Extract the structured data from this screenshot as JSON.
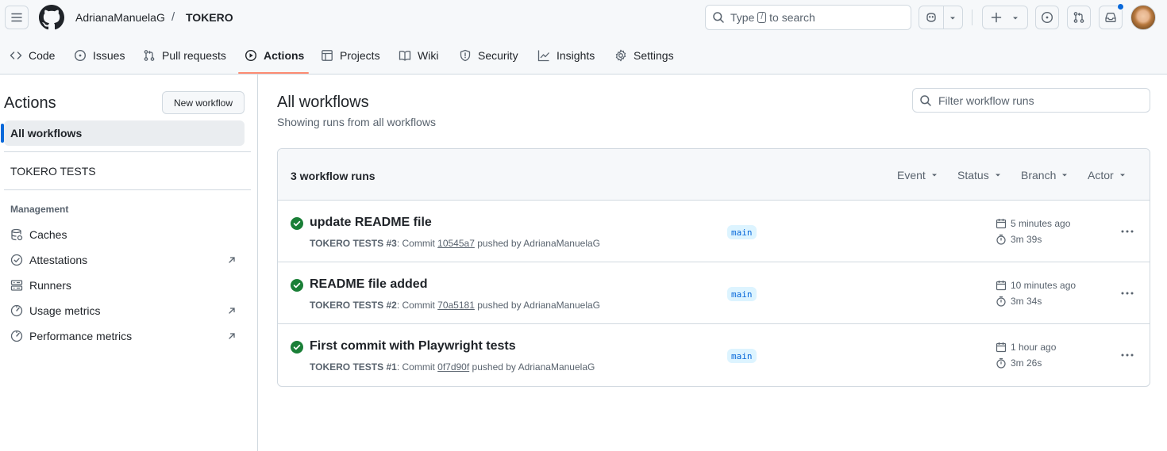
{
  "header": {
    "owner": "AdrianaManuelaG",
    "separator": "/",
    "repo": "TOKERO",
    "search": {
      "prefix": "Type",
      "key": "/",
      "suffix": "to search"
    }
  },
  "tabs": [
    {
      "label": "Code",
      "icon": "code-icon"
    },
    {
      "label": "Issues",
      "icon": "issue-icon"
    },
    {
      "label": "Pull requests",
      "icon": "pull-request-icon"
    },
    {
      "label": "Actions",
      "icon": "play-icon",
      "selected": true
    },
    {
      "label": "Projects",
      "icon": "table-icon"
    },
    {
      "label": "Wiki",
      "icon": "book-icon"
    },
    {
      "label": "Security",
      "icon": "shield-icon"
    },
    {
      "label": "Insights",
      "icon": "graph-icon"
    },
    {
      "label": "Settings",
      "icon": "gear-icon"
    }
  ],
  "sidebar": {
    "title": "Actions",
    "new_workflow": "New workflow",
    "all_workflows": "All workflows",
    "workflow": "TOKERO TESTS",
    "management_heading": "Management",
    "items": [
      {
        "label": "Caches",
        "icon": "database-icon"
      },
      {
        "label": "Attestations",
        "icon": "verified-icon",
        "external": true
      },
      {
        "label": "Runners",
        "icon": "server-icon"
      },
      {
        "label": "Usage metrics",
        "icon": "meter-icon",
        "external": true
      },
      {
        "label": "Performance metrics",
        "icon": "meter-icon",
        "external": true
      }
    ]
  },
  "main": {
    "title": "All workflows",
    "subtitle": "Showing runs from all workflows",
    "filter_placeholder": "Filter workflow runs",
    "runs_count": "3 workflow runs",
    "filters": [
      "Event",
      "Status",
      "Branch",
      "Actor"
    ],
    "runs": [
      {
        "title": "update README file",
        "workflow": "TOKERO TESTS #3",
        "commit_label": ": Commit",
        "sha": "10545a7",
        "pushed_by": "pushed by AdrianaManuelaG",
        "branch": "main",
        "when": "5 minutes ago",
        "duration": "3m 39s",
        "status": "success"
      },
      {
        "title": "README file added",
        "workflow": "TOKERO TESTS #2",
        "commit_label": ": Commit",
        "sha": "70a5181",
        "pushed_by": "pushed by AdrianaManuelaG",
        "branch": "main",
        "when": "10 minutes ago",
        "duration": "3m 34s",
        "status": "success"
      },
      {
        "title": "First commit with Playwright tests",
        "workflow": "TOKERO TESTS #1",
        "commit_label": ": Commit",
        "sha": "0f7d90f",
        "pushed_by": "pushed by AdrianaManuelaG",
        "branch": "main",
        "when": "1 hour ago",
        "duration": "3m 26s",
        "status": "success"
      }
    ]
  },
  "colors": {
    "accent": "#0969da",
    "success": "#1a7f37",
    "tab_underline": "#fd8c73",
    "branch_bg": "#ddf4ff"
  }
}
